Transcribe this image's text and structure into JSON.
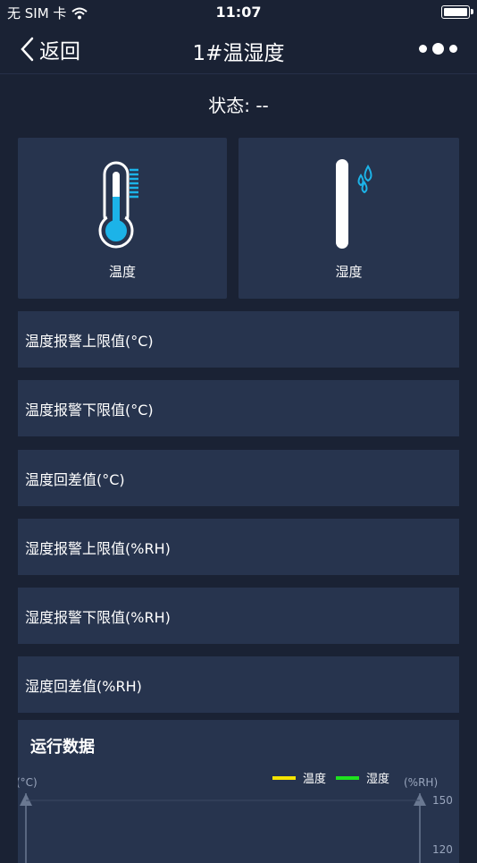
{
  "statusbar": {
    "carrier": "无 SIM 卡",
    "time": "11:07"
  },
  "nav": {
    "back_label": "返回",
    "title": "1#温湿度"
  },
  "status": {
    "text": "状态: --"
  },
  "sensors": [
    {
      "label": "温度",
      "icon": "thermometer-icon",
      "color": "#1cb3e8"
    },
    {
      "label": "湿度",
      "icon": "humidity-gauge-icon",
      "color": "#1cb3e8"
    }
  ],
  "params": [
    "温度报警上限值(°C)",
    "温度报警下限值(°C)",
    "温度回差值(°C)",
    "湿度报警上限值(%RH)",
    "湿度报警下限值(%RH)",
    "湿度回差值(%RH)"
  ],
  "run_data": {
    "title": "运行数据",
    "chart_data": {
      "type": "line",
      "left_unit": "(°C)",
      "right_unit": "(%RH)",
      "right_ticks": [
        "150",
        "120"
      ],
      "series": [
        {
          "name": "温度",
          "color": "#f5e400",
          "values": []
        },
        {
          "name": "湿度",
          "color": "#1ee21e",
          "values": []
        }
      ]
    }
  }
}
